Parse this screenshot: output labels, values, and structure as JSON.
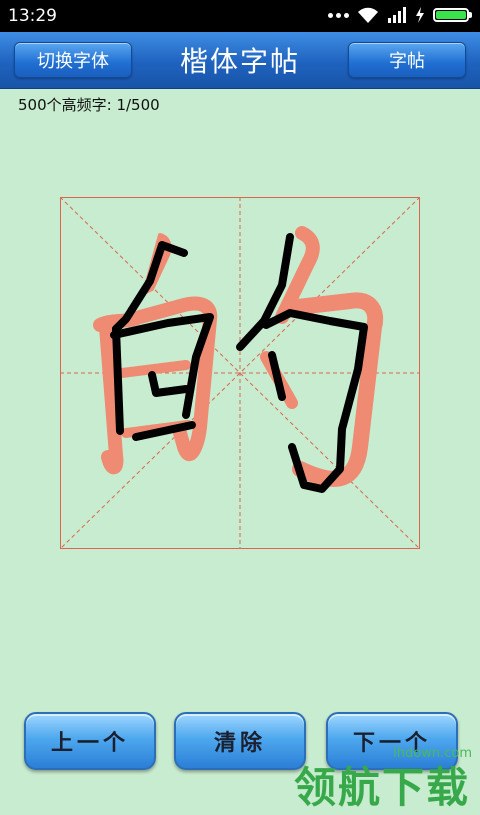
{
  "status_bar": {
    "time": "13:29",
    "icons": [
      "more-dots-icon",
      "wifi-icon",
      "signal-icon",
      "charging-icon",
      "battery-icon"
    ]
  },
  "header": {
    "left_button": "切换字体",
    "title": "楷体字帖",
    "right_button": "字帖"
  },
  "progress_text": "500个高频字: 1/500",
  "practice_char": "的",
  "colors": {
    "background": "#c8eccf",
    "header": "#1f63bf",
    "grid_line": "#d9664d",
    "model_stroke": "#ef8a73",
    "user_stroke": "#000000"
  },
  "bottom_buttons": {
    "prev": "上一个",
    "clear": "清除",
    "next": "下一个"
  },
  "watermark": {
    "url": "lhdown.com",
    "text": "领航下载"
  }
}
